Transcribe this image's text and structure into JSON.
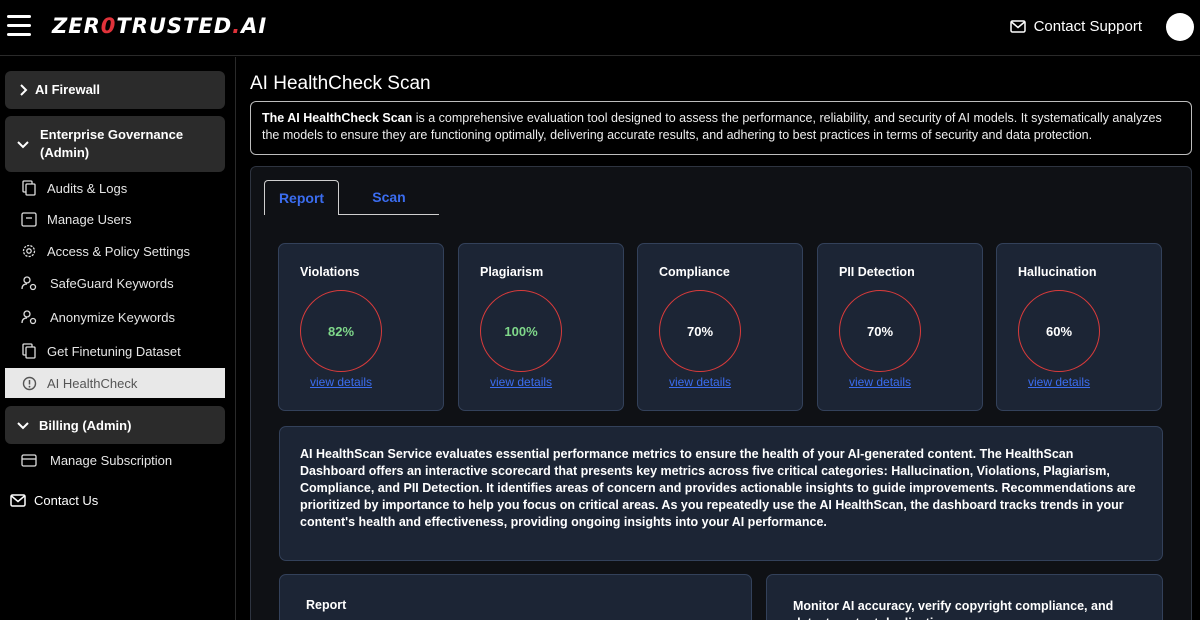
{
  "header": {
    "logo_main": "ZER",
    "logo_zero": "0",
    "logo_rest": "TRUSTED",
    "logo_dot": ".",
    "logo_ai": "AI",
    "contact_support": "Contact Support"
  },
  "sidebar": {
    "groups": [
      {
        "label": "AI Firewall",
        "expanded": false
      },
      {
        "label": "Enterprise Governance (Admin)",
        "expanded": true
      },
      {
        "label": "Billing (Admin)",
        "expanded": true
      }
    ],
    "items": [
      {
        "label": "Audits & Logs",
        "icon": "copy-icon"
      },
      {
        "label": "Manage Users",
        "icon": "user-card-icon"
      },
      {
        "label": "Access & Policy Settings",
        "icon": "gear-icon"
      },
      {
        "label": "SafeGuard Keywords",
        "icon": "user-shield-icon"
      },
      {
        "label": "Anonymize Keywords",
        "icon": "user-shield-icon"
      },
      {
        "label": "Get Finetuning Dataset",
        "icon": "copy-icon"
      },
      {
        "label": "AI HealthCheck",
        "icon": "alert-circle-icon",
        "active": true
      },
      {
        "label": "Manage Subscription",
        "icon": "card-icon"
      }
    ],
    "contact_us": "Contact Us"
  },
  "main": {
    "title": "AI HealthCheck Scan",
    "description_bold": "The AI HealthCheck Scan",
    "description_rest": " is a comprehensive evaluation tool designed to assess the performance, reliability, and security of AI models. It systematically analyzes the models to ensure they are functioning optimally, delivering accurate results, and adhering to best practices in terms of security and data protection.",
    "tabs": [
      {
        "label": "Report",
        "active": true
      },
      {
        "label": "Scan",
        "active": false
      }
    ],
    "metrics": [
      {
        "label": "Violations",
        "value": "82%",
        "highlight": "green",
        "link": "view details"
      },
      {
        "label": "Plagiarism",
        "value": "100%",
        "highlight": "green",
        "link": "view details"
      },
      {
        "label": "Compliance",
        "value": "70%",
        "highlight": "white",
        "link": "view details"
      },
      {
        "label": "PII Detection",
        "value": "70%",
        "highlight": "white",
        "link": "view details"
      },
      {
        "label": "Hallucination",
        "value": "60%",
        "highlight": "white",
        "link": "view details"
      }
    ],
    "info_text": "AI HealthScan Service evaluates essential performance metrics to ensure the health of your AI-generated content. The HealthScan Dashboard offers an interactive scorecard that presents key metrics across five critical categories: Hallucination, Violations, Plagiarism, Compliance, and PII Detection. It identifies areas of concern and provides actionable insights to guide improvements. Recommendations are prioritized by importance to help you focus on critical areas. As you repeatedly use the AI HealthScan, the dashboard tracks trends in your content's health and effectiveness, providing ongoing insights into your AI performance.",
    "bottom_left_title": "Report",
    "bottom_right_title": "Monitor AI accuracy, verify copyright compliance, and detect content duplication."
  },
  "colors": {
    "accent_blue": "#3b6df0",
    "ring_red": "#d93b3b",
    "good_green": "#7fd88a",
    "card_bg": "#1c2535"
  }
}
